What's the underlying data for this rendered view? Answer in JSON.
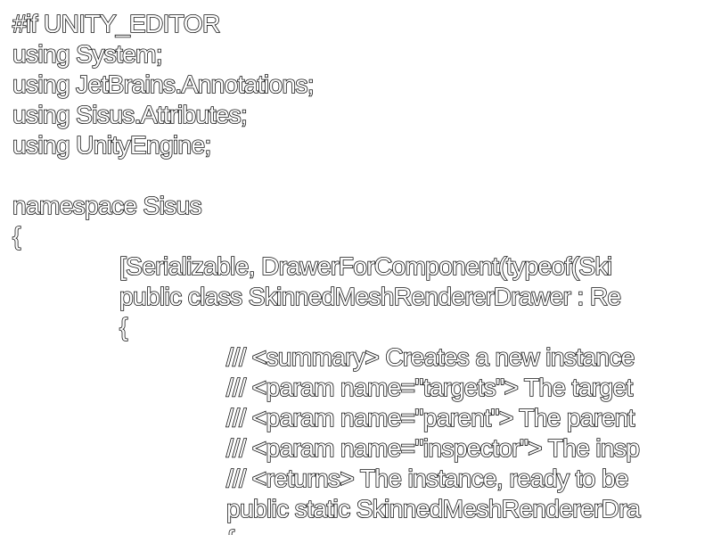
{
  "editor": {
    "lines": [
      "#if UNITY_EDITOR",
      "using System;",
      "using JetBrains.Annotations;",
      "using Sisus.Attributes;",
      "using UnityEngine;",
      "",
      "namespace Sisus",
      "{",
      "[Serializable, DrawerForComponent(typeof(Ski",
      "public class SkinnedMeshRendererDrawer : Re",
      "{",
      "/// <summary> Creates a new instance",
      "/// <param name=\"targets\"> The target",
      "/// <param name=\"parent\"> The parent",
      "/// <param name=\"inspector\"> The insp",
      "/// <returns> The instance, ready to be",
      "public static SkinnedMeshRendererDra",
      "{"
    ]
  }
}
